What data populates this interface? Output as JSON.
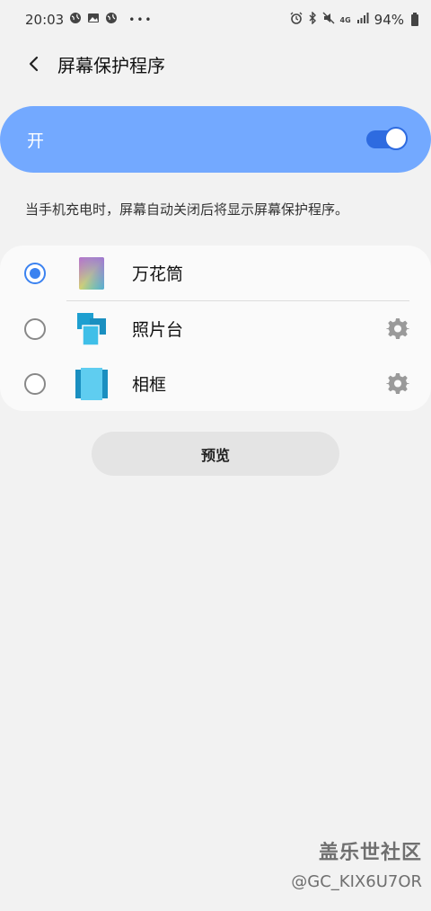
{
  "status_bar": {
    "time": "20:03",
    "battery": "94%",
    "network": "4G"
  },
  "header": {
    "title": "屏幕保护程序"
  },
  "master_switch": {
    "label": "开",
    "on": true
  },
  "description": "当手机充电时，屏幕自动关闭后将显示屏幕保护程序。",
  "options": [
    {
      "label": "万花筒",
      "selected": true,
      "has_settings": false
    },
    {
      "label": "照片台",
      "selected": false,
      "has_settings": true
    },
    {
      "label": "相框",
      "selected": false,
      "has_settings": true
    }
  ],
  "preview_button": {
    "label": "预览"
  },
  "watermark": {
    "brand": "盖乐世社区",
    "user": "@GC_KIX6U7OR"
  },
  "colors": {
    "accent": "#3b82f0",
    "master_card": "#73a9ff",
    "background": "#f2f2f2"
  }
}
